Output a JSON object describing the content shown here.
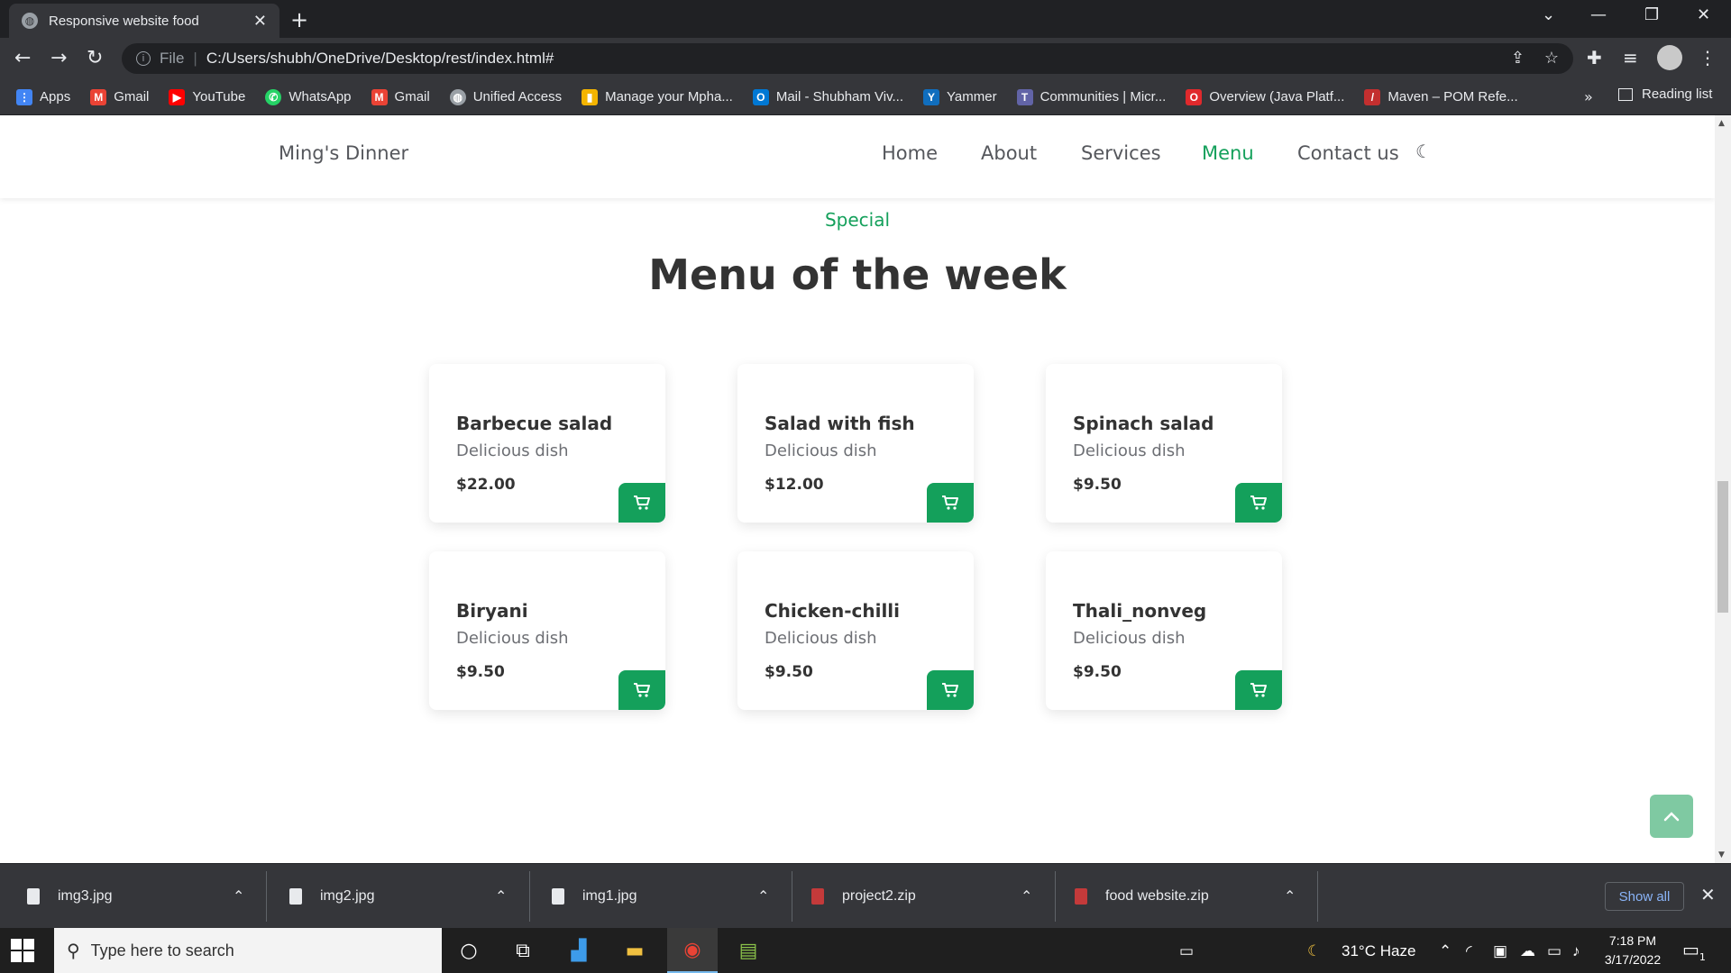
{
  "browser": {
    "tab_title": "Responsive website food",
    "new_tab": "+",
    "url_scheme": "File",
    "url": "C:/Users/shubh/OneDrive/Desktop/rest/index.html#",
    "bookmarks": [
      {
        "label": "Apps",
        "icon": "apps-grid-icon",
        "color": "#4285f4"
      },
      {
        "label": "Gmail",
        "icon": "gmail-icon",
        "color": "#ea4335"
      },
      {
        "label": "YouTube",
        "icon": "youtube-icon",
        "color": "#ff0000"
      },
      {
        "label": "WhatsApp",
        "icon": "whatsapp-icon",
        "color": "#25d366"
      },
      {
        "label": "Gmail",
        "icon": "gmail-icon",
        "color": "#ea4335"
      },
      {
        "label": "Unified Access",
        "icon": "globe-icon",
        "color": "#9aa0a6"
      },
      {
        "label": "Manage your Mpha...",
        "icon": "bar-chart-icon",
        "color": "#f4b400"
      },
      {
        "label": "Mail - Shubham Viv...",
        "icon": "outlook-icon",
        "color": "#0078d4"
      },
      {
        "label": "Yammer",
        "icon": "yammer-icon",
        "color": "#106ebe"
      },
      {
        "label": "Communities | Micr...",
        "icon": "teams-icon",
        "color": "#6264a7"
      },
      {
        "label": "Overview (Java Platf...",
        "icon": "oracle-icon",
        "color": "#e0292c"
      },
      {
        "label": "Maven – POM Refe...",
        "icon": "maven-feather-icon",
        "color": "#c32f2f"
      }
    ],
    "more_bookmarks": "»",
    "reading_list": "Reading list"
  },
  "site": {
    "logo": "Ming's Dinner",
    "nav": [
      "Home",
      "About",
      "Services",
      "Menu",
      "Contact us"
    ],
    "active_nav": "Menu",
    "accent_color": "#14a05b",
    "subtitle": "Special",
    "title": "Menu of the week",
    "menu": [
      {
        "name": "Barbecue salad",
        "desc": "Delicious dish",
        "price": "$22.00"
      },
      {
        "name": "Salad with fish",
        "desc": "Delicious dish",
        "price": "$12.00"
      },
      {
        "name": "Spinach salad",
        "desc": "Delicious dish",
        "price": "$9.50"
      },
      {
        "name": "Biryani",
        "desc": "Delicious dish",
        "price": "$9.50"
      },
      {
        "name": "Chicken-chilli",
        "desc": "Delicious dish",
        "price": "$9.50"
      },
      {
        "name": "Thali_nonveg",
        "desc": "Delicious dish",
        "price": "$9.50"
      }
    ]
  },
  "downloads": {
    "files": [
      {
        "name": "img3.jpg",
        "type": "image"
      },
      {
        "name": "img2.jpg",
        "type": "image"
      },
      {
        "name": "img1.jpg",
        "type": "image"
      },
      {
        "name": "project2.zip",
        "type": "zip"
      },
      {
        "name": "food website.zip",
        "type": "zip"
      }
    ],
    "show_all": "Show all"
  },
  "taskbar": {
    "search_placeholder": "Type here to search",
    "weather": "31°C  Haze",
    "time": "7:18 PM",
    "date": "3/17/2022",
    "notification_count": "1"
  }
}
